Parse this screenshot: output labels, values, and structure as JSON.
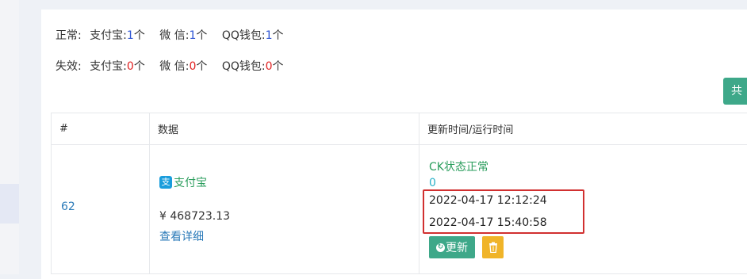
{
  "stats": {
    "normal": {
      "label": "正常:",
      "alipay_label": "支付宝:",
      "alipay_count": "1",
      "unit1": "个",
      "wechat_label": "微 信:",
      "wechat_count": "1",
      "unit2": "个",
      "qq_label": "QQ钱包:",
      "qq_count": "1",
      "unit3": "个"
    },
    "invalid": {
      "label": "失效:",
      "alipay_label": "支付宝:",
      "alipay_count": "0",
      "unit1": "个",
      "wechat_label": "微 信:",
      "wechat_count": "0",
      "unit2": "个",
      "qq_label": "QQ钱包:",
      "qq_count": "0",
      "unit3": "个"
    }
  },
  "total_button_label": "共",
  "table": {
    "headers": [
      "#",
      "数据",
      "更新时间/运行时间"
    ],
    "rows": [
      {
        "id": "62",
        "pay_type": "支付宝",
        "amount": "¥ 468723.13",
        "detail_link": "查看详细",
        "ck_status": "CK状态正常",
        "count": "0",
        "update_time": "2022-04-17 12:12:24",
        "run_time": "2022-04-17 15:40:58",
        "update_button": "更新"
      }
    ]
  },
  "colors": {
    "accent_green": "#3ea889",
    "warning_yellow": "#f0b429",
    "highlight_red": "#d13030",
    "count_blue": "#2f55d4",
    "count_red": "#e02020"
  }
}
